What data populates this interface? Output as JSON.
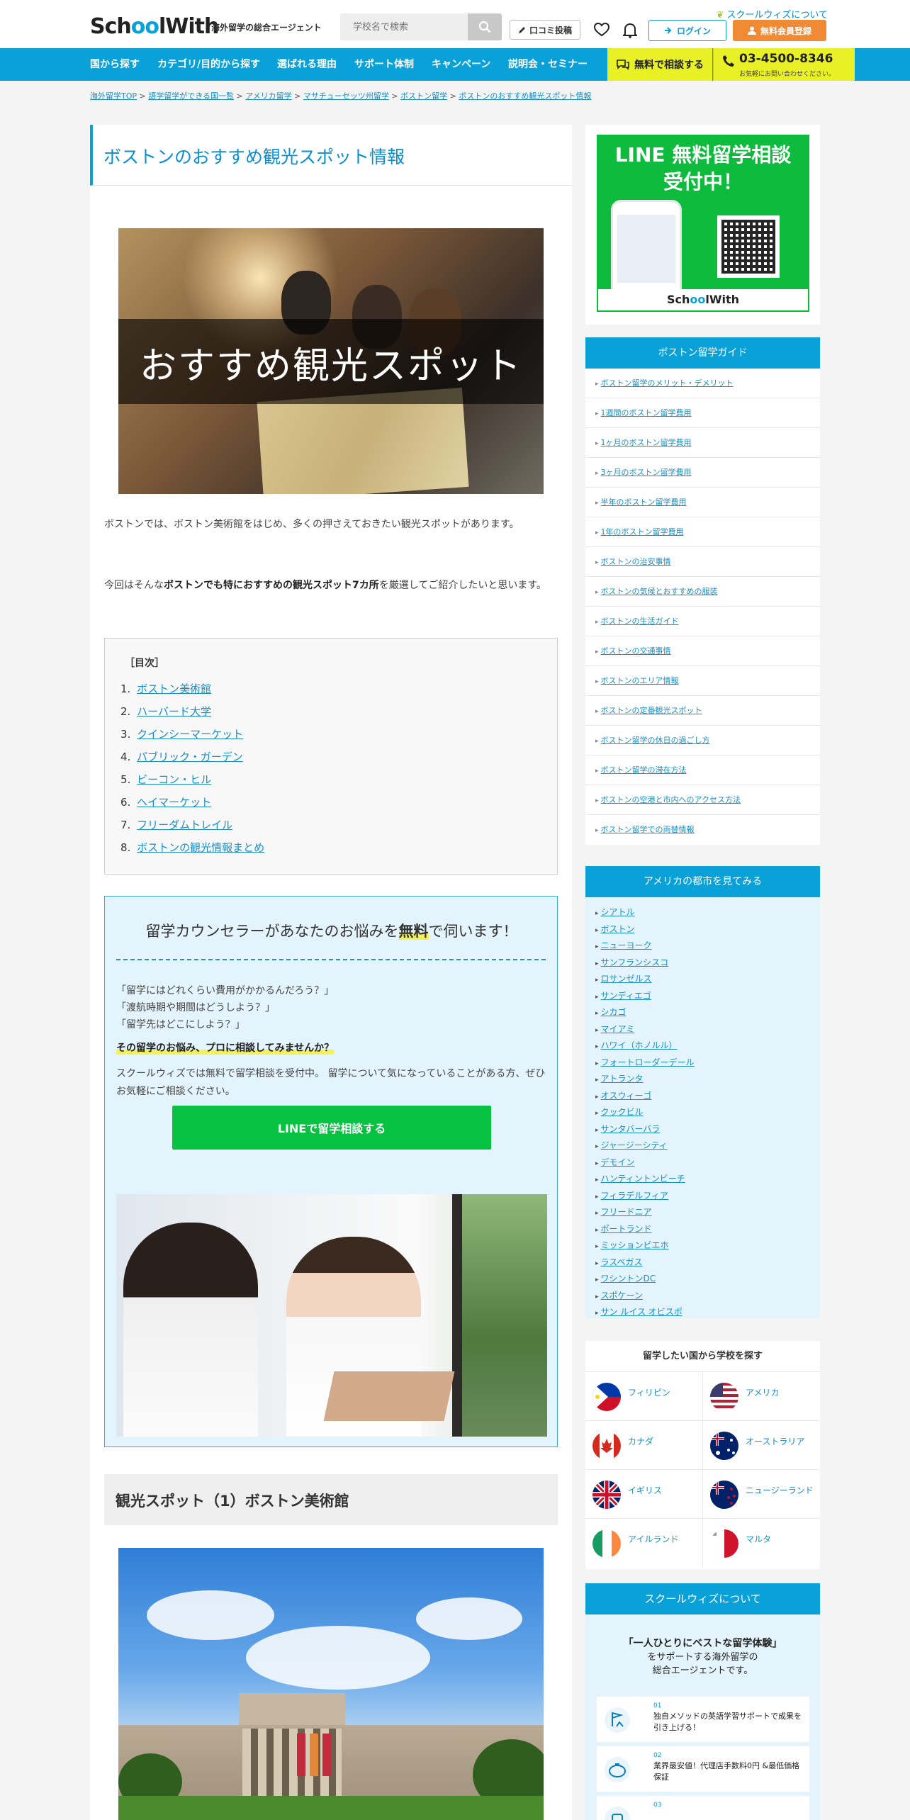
{
  "header": {
    "logo_a": "Sch",
    "logo_oo": "oo",
    "logo_b": "lWith",
    "tagline": "海外留学の総合エージェント",
    "search_placeholder": "学校名で検索",
    "about_link": "スクールウィズについて",
    "review_button": "口コミ投稿",
    "login_button": "ログイン",
    "register_button": "無料会員登録"
  },
  "nav": {
    "items": [
      "国から探す",
      "カテゴリ/目的から探す",
      "選ばれる理由",
      "サポート体制",
      "キャンペーン",
      "説明会・セミナー"
    ],
    "consult_button": "無料で相談する",
    "phone": "03-4500-8346",
    "phone_sub": "お気軽にお問い合わせください。"
  },
  "breadcrumb": [
    "海外留学TOP",
    "語学留学ができる国一覧",
    "アメリカ留学",
    "マサチューセッツ州留学",
    "ボストン留学",
    "ボストンのおすすめ観光スポット情報"
  ],
  "article": {
    "title": "ボストンのおすすめ観光スポット情報",
    "hero_text": "おすすめ観光スポット",
    "intro1": "ボストンでは、ボストン美術館をはじめ、多くの押さえておきたい観光スポットがあります。",
    "intro2_pre": "今回はそんな",
    "intro2_bold": "ボストンでも特におすすめの観光スポット7カ所",
    "intro2_post": "を厳選してご紹介したいと思います。",
    "toc_title": "［目次］",
    "toc": [
      "ボストン美術館",
      "ハーバード大学",
      "クインシーマーケット",
      "パブリック・ガーデン",
      "ビーコン・ヒル",
      "ヘイマーケット",
      "フリーダムトレイル",
      "ボストンの観光情報まとめ"
    ],
    "counsel": {
      "heading_pre": "留学カウンセラーがあなたのお悩みを",
      "heading_hl": "無料",
      "heading_post": "で伺います！",
      "q1": "「留学にはどれくらい費用がかかるんだろう？」",
      "q2": "「渡航時期や期間はどうしよう？」",
      "q3": "「留学先はどこにしよう？」",
      "emph": "その留学のお悩み、プロに相談してみませんか？",
      "desc": "スクールウィズでは無料で留学相談を受付中。 留学について気になっていることがある方、ぜひお気軽にご相談ください。",
      "line_button": "LINEで留学相談する"
    },
    "section1": "観光スポット（1）ボストン美術館"
  },
  "sidebar": {
    "line_title1": "LINE 無料留学相談",
    "line_title2": "受付中！",
    "guide_title": "ボストン留学ガイド",
    "guide": [
      "ボストン留学のメリット・デメリット",
      "1週間のボストン留学費用",
      "1ヶ月のボストン留学費用",
      "3ヶ月のボストン留学費用",
      "半年のボストン留学費用",
      "1年のボストン留学費用",
      "ボストンの治安事情",
      "ボストンの気候とおすすめの服装",
      "ボストンの生活ガイド",
      "ボストンの交通事情",
      "ボストンのエリア情報",
      "ボストンの定番観光スポット",
      "ボストン留学の休日の過ごし方",
      "ボストン留学の滞在方法",
      "ボストンの空港と市内へのアクセス方法",
      "ボストン留学での両替情報"
    ],
    "cities_title": "アメリカの都市を見てみる",
    "cities": [
      "シアトル",
      "ボストン",
      "ニューヨーク",
      "サンフランシスコ",
      "ロサンゼルス",
      "サンディエゴ",
      "シカゴ",
      "マイアミ",
      "ハワイ（ホノルル）",
      "フォートローダーデール",
      "アトランタ",
      "オスウィーゴ",
      "クックビル",
      "サンタバーバラ",
      "ジャージーシティ",
      "デモイン",
      "ハンティントンビーチ",
      "フィラデルフィア",
      "フリードニア",
      "ポートランド",
      "ミッションビエホ",
      "ラスベガス",
      "ワシントンDC",
      "スポケーン",
      "サン ルイス オビスポ"
    ],
    "country_title": "留学したい国から学校を探す",
    "countries": [
      "フィリピン",
      "アメリカ",
      "カナダ",
      "オーストラリア",
      "イギリス",
      "ニュージーランド",
      "アイルランド",
      "マルタ"
    ],
    "about_title": "スクールウィズについて",
    "about_lead1": "「一人ひとりにベストな留学体験」",
    "about_lead2": "をサポートする海外留学の",
    "about_lead3": "総合エージェントです。",
    "about_cards": [
      {
        "no": "01",
        "text": "独自メソッドの英語学習サポートで成果を引き上げる！"
      },
      {
        "no": "02",
        "text": "業界最安値！代理店手数料0円 &最低価格保証"
      },
      {
        "no": "03",
        "text": ""
      }
    ]
  },
  "colors": {
    "brand_blue": "#0aa0d8",
    "accent_orange": "#f08a35",
    "line_green": "#06c240",
    "yellow": "#e9f025"
  }
}
